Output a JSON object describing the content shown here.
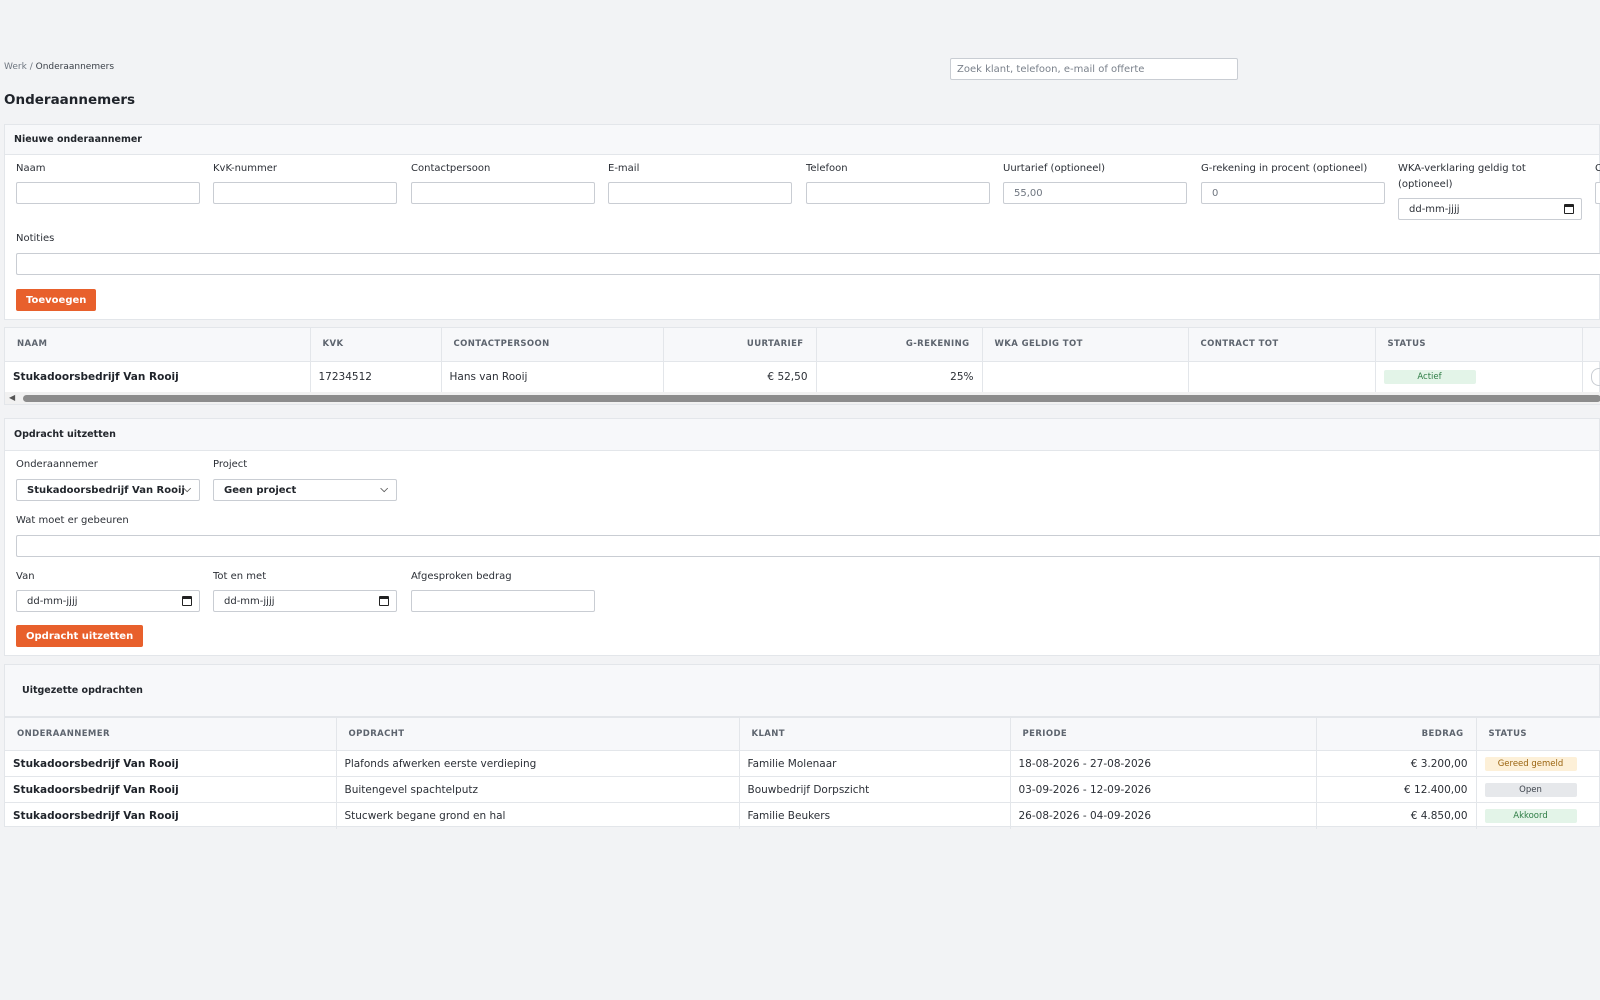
{
  "breadcrumb": {
    "parent": "Werk",
    "separator": "/",
    "current": "Onderaannemers"
  },
  "search": {
    "placeholder": "Zoek klant, telefoon, e-mail of offerte"
  },
  "page_title": "Onderaannemers",
  "new_sub": {
    "heading": "Nieuwe onderaannemer",
    "fields": {
      "naam": "Naam",
      "kvk": "KvK-nummer",
      "contact": "Contactpersoon",
      "email": "E-mail",
      "telefoon": "Telefoon",
      "uurtarief": "Uurtarief (optioneel)",
      "uurtarief_ph": "55,00",
      "grek": "G-rekening in procent (optioneel)",
      "grek_ph": "0",
      "wka_line1": "WKA-verklaring geldig tot",
      "wka_line2": "(optioneel)",
      "wka_ph": "dd-mm-jjjj",
      "extra_partial": "C",
      "notities": "Notities"
    },
    "add_button": "Toevoegen"
  },
  "subs_table": {
    "columns": [
      "NAAM",
      "KVK",
      "CONTACTPERSOON",
      "UURTARIEF",
      "G-REKENING",
      "WKA GELDIG TOT",
      "CONTRACT TOT",
      "STATUS"
    ],
    "rows": [
      {
        "naam": "Stukadoorsbedrijf Van Rooij",
        "kvk": "17234512",
        "contact": "Hans van Rooij",
        "uurtarief": "€ 52,50",
        "grek": "25%",
        "wka": "",
        "contract": "",
        "status": "Actief"
      }
    ]
  },
  "assign": {
    "heading": "Opdracht uitzetten",
    "sub_label": "Onderaannemer",
    "sub_value": "Stukadoorsbedrijf Van Rooij",
    "project_label": "Project",
    "project_value": "Geen project",
    "what_label": "Wat moet er gebeuren",
    "van_label": "Van",
    "van_ph": "dd-mm-jjjj",
    "tot_label": "Tot en met",
    "tot_ph": "dd-mm-jjjj",
    "bedrag_label": "Afgesproken bedrag",
    "button": "Opdracht uitzetten"
  },
  "orders": {
    "heading": "Uitgezette opdrachten",
    "columns": [
      "ONDERAANNEMER",
      "OPDRACHT",
      "KLANT",
      "PERIODE",
      "BEDRAG",
      "STATUS"
    ],
    "rows": [
      {
        "sub": "Stukadoorsbedrijf Van Rooij",
        "opdracht": "Plafonds afwerken eerste verdieping",
        "klant": "Familie Molenaar",
        "periode": "18-08-2026 - 27-08-2026",
        "bedrag": "€ 3.200,00",
        "status": "Gereed gemeld",
        "status_color": "#fdf0d8"
      },
      {
        "sub": "Stukadoorsbedrijf Van Rooij",
        "opdracht": "Buitengevel spachtelputz",
        "klant": "Bouwbedrijf Dorpszicht",
        "periode": "03-09-2026 - 12-09-2026",
        "bedrag": "€ 12.400,00",
        "status": "Open",
        "status_color": "#e6e8eb"
      },
      {
        "sub": "Stukadoorsbedrijf Van Rooij",
        "opdracht": "Stucwerk begane grond en hal",
        "klant": "Familie Beukers",
        "periode": "26-08-2026 - 04-09-2026",
        "bedrag": "€ 4.850,00",
        "status": "Akkoord",
        "status_color": "#e3f4e8"
      }
    ]
  },
  "colors": {
    "accent": "#e8602c",
    "background": "#f2f3f5"
  }
}
